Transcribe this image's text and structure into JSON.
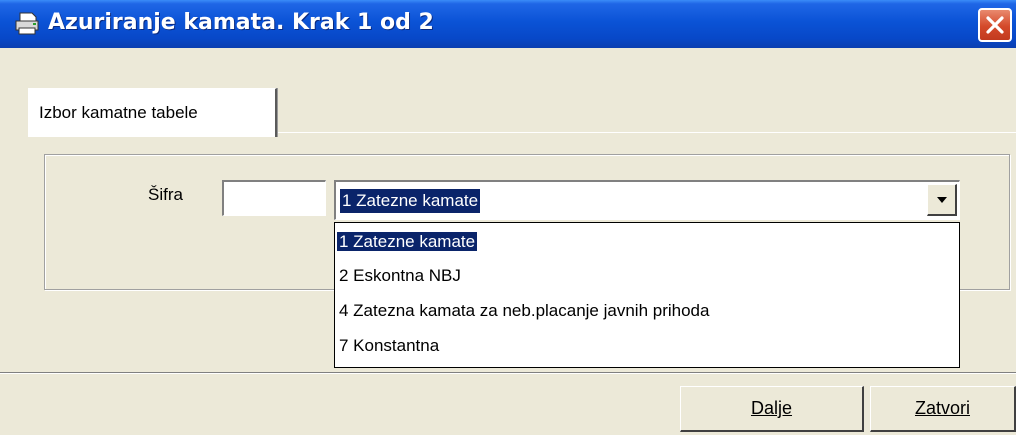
{
  "window": {
    "title": "Azuriranje kamata. Krak 1 od 2",
    "icon": "printer-icon",
    "title_bar_color": "#0b53d6",
    "close_color": "#d4492a"
  },
  "tabs": [
    {
      "label": "Izbor kamatne tabele",
      "active": true
    }
  ],
  "form": {
    "sifra_label": "Šifra",
    "sifra_value": "",
    "combo_selected": "1 Zatezne kamate"
  },
  "dropdown": {
    "options": [
      "1 Zatezne kamate",
      "2 Eskontna NBJ",
      "4 Zatezna kamata za neb.placanje javnih prihoda",
      "7 Konstantna"
    ],
    "selected_index": 0,
    "highlight_color": "#0a246a"
  },
  "buttons": {
    "next_label": "Dalje",
    "close_label": "Zatvori"
  }
}
